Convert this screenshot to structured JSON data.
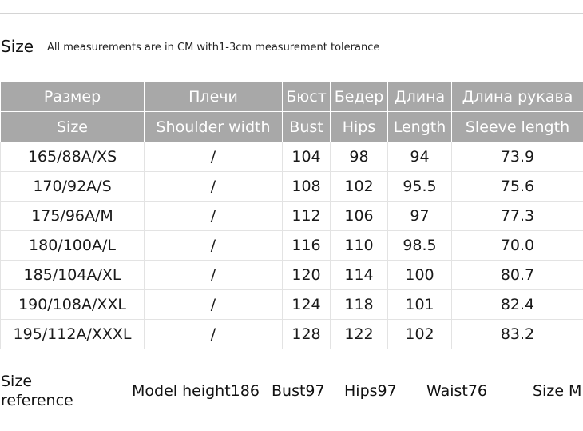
{
  "header": {
    "title": "Size",
    "note": "All measurements are in CM with1-3cm measurement tolerance"
  },
  "table": {
    "header_ru": [
      "Размер",
      "Плечи",
      "Бюст",
      "Бедер",
      "Длина",
      "Длина рукава"
    ],
    "header_en": [
      "Size",
      "Shoulder width",
      "Bust",
      "Hips",
      "Length",
      "Sleeve length"
    ],
    "rows": [
      [
        "165/88A/XS",
        "/",
        "104",
        "98",
        "94",
        "73.9"
      ],
      [
        "170/92A/S",
        "/",
        "108",
        "102",
        "95.5",
        "75.6"
      ],
      [
        "175/96A/M",
        "/",
        "112",
        "106",
        "97",
        "77.3"
      ],
      [
        "180/100A/L",
        "/",
        "116",
        "110",
        "98.5",
        "70.0"
      ],
      [
        "185/104A/XL",
        "/",
        "120",
        "114",
        "100",
        "80.7"
      ],
      [
        "190/108A/XXL",
        "/",
        "124",
        "118",
        "101",
        "82.4"
      ],
      [
        "195/112A/XXXL",
        "/",
        "128",
        "122",
        "102",
        "83.2"
      ]
    ]
  },
  "reference": {
    "label_line1": "Size",
    "label_line2": "reference",
    "model_height": "Model height186",
    "bust": "Bust97",
    "hips": "Hips97",
    "waist": "Waist76",
    "size": "Size M"
  },
  "colors": {
    "header_bg": "#a8a8a8",
    "header_text": "#ffffff",
    "grid_line": "#e3e3e3"
  }
}
